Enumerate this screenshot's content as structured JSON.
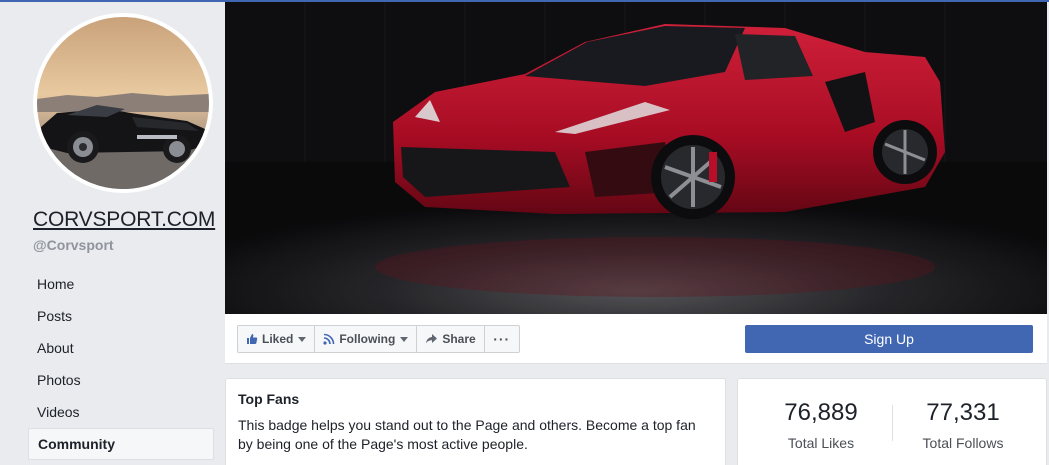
{
  "page": {
    "name": "CORVSPORT.COM",
    "handle": "@Corvsport"
  },
  "nav": {
    "items": [
      {
        "label": "Home"
      },
      {
        "label": "Posts"
      },
      {
        "label": "About"
      },
      {
        "label": "Photos"
      },
      {
        "label": "Videos"
      },
      {
        "label": "Community",
        "active": true
      }
    ]
  },
  "actions": {
    "liked_label": "Liked",
    "following_label": "Following",
    "share_label": "Share",
    "more_label": "···",
    "signup_label": "Sign Up"
  },
  "top_fans": {
    "title": "Top Fans",
    "body": "This badge helps you stand out to the Page and others. Become a top fan by being one of the Page's most active people."
  },
  "stats": {
    "likes_value": "76,889",
    "likes_label": "Total Likes",
    "follows_value": "77,331",
    "follows_label": "Total Follows"
  },
  "colors": {
    "brand": "#4267b2",
    "background": "#e9ebee",
    "car": "#c8102e"
  },
  "icons": {
    "liked": "thumbs-up-icon",
    "following": "rss-icon",
    "share": "share-arrow-icon",
    "more": "ellipsis-icon"
  }
}
